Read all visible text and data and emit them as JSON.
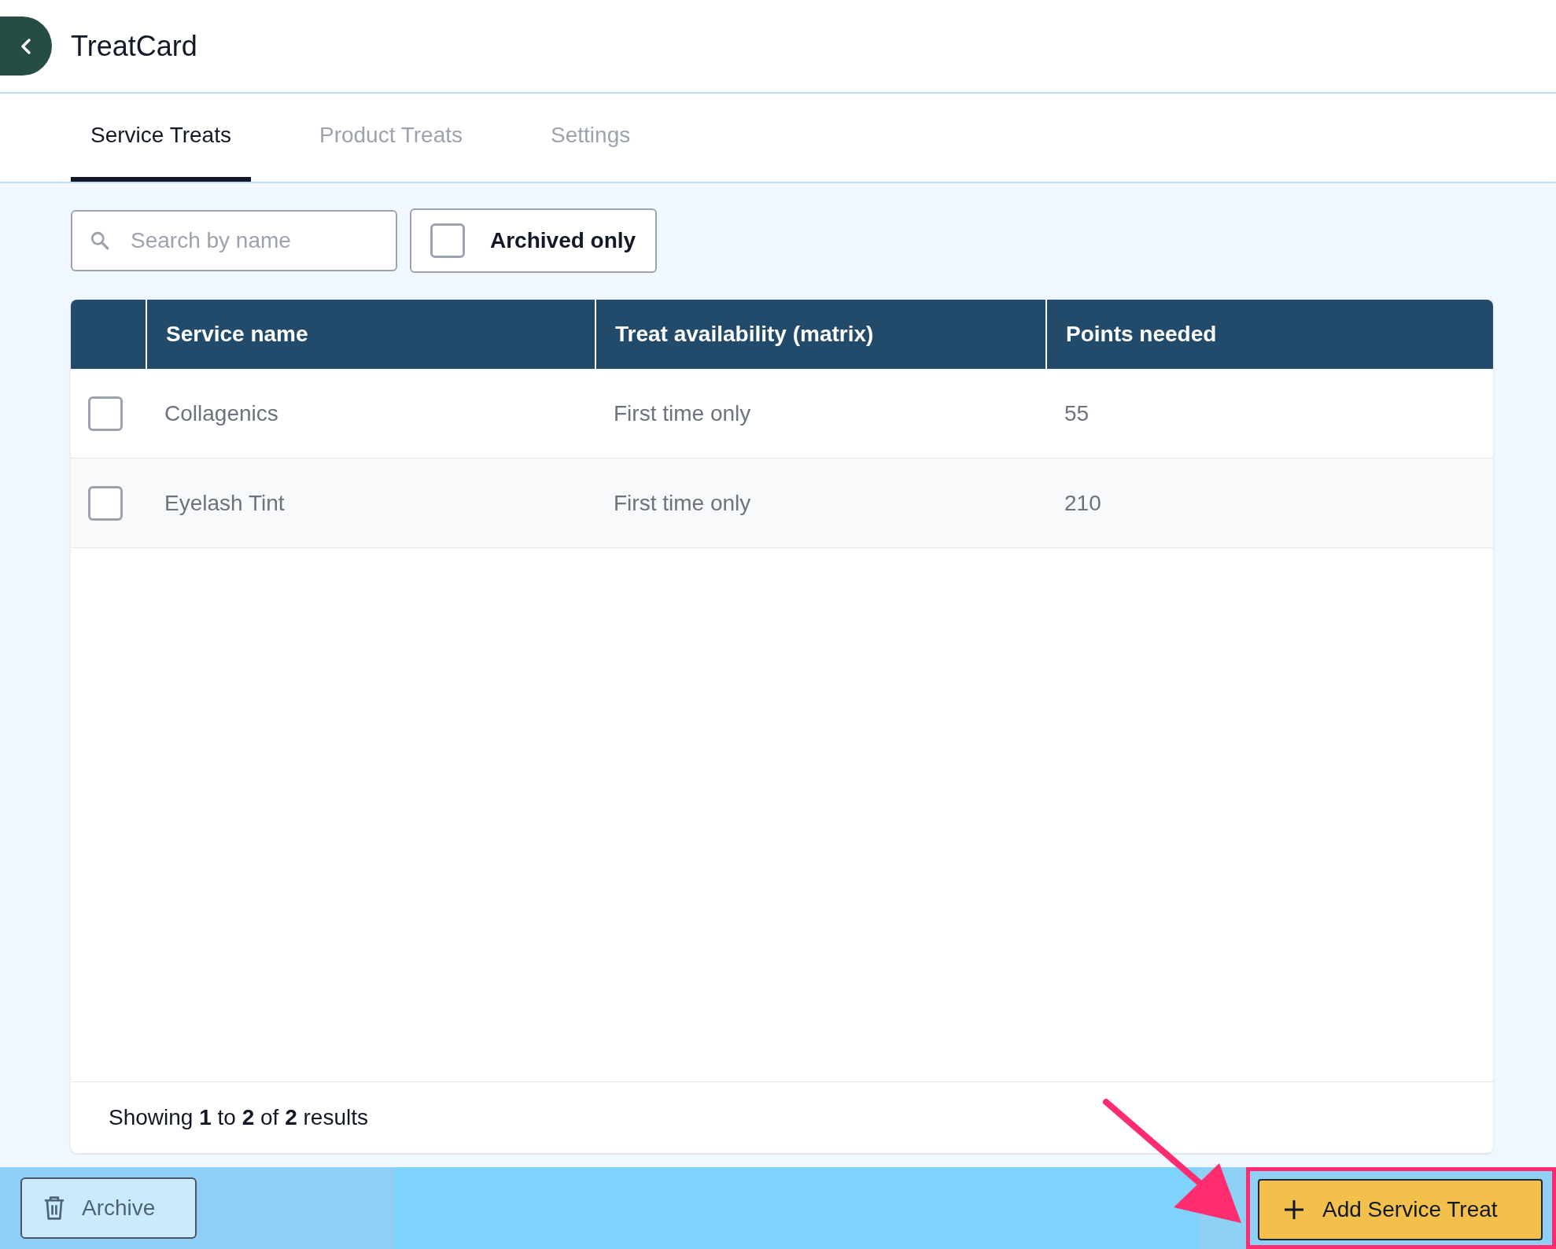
{
  "header": {
    "title": "TreatCard"
  },
  "tabs": [
    {
      "label": "Service Treats",
      "selected": true
    },
    {
      "label": "Product Treats",
      "selected": false
    },
    {
      "label": "Settings",
      "selected": false
    }
  ],
  "search": {
    "placeholder": "Search by name"
  },
  "archived_filter": {
    "label": "Archived only",
    "checked": false
  },
  "table": {
    "columns": [
      "Service name",
      "Treat availability (matrix)",
      "Points needed"
    ],
    "rows": [
      {
        "checked": false,
        "cells": [
          "Collagenics",
          "First time only",
          "55"
        ]
      },
      {
        "checked": false,
        "cells": [
          "Eyelash Tint",
          "First time only",
          "210"
        ]
      }
    ],
    "footer": "Showing **1** to **2** of **2** results"
  },
  "bottom_bar": {
    "archive_button": "Archive",
    "add_button": "Add Service Treat",
    "add_highlighted": true
  }
}
